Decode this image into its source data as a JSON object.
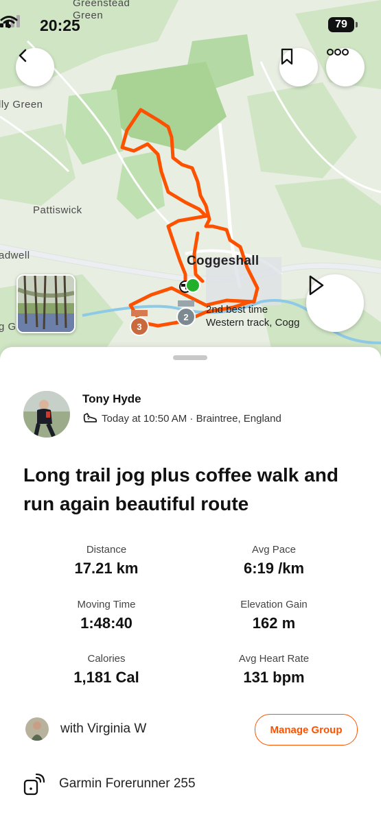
{
  "status_bar": {
    "time": "20:25",
    "battery": "79"
  },
  "map": {
    "places": {
      "greenstead": "Greenstead\nGreen",
      "lly_green": "lly Green",
      "pattiswick": "Pattiswick",
      "adwell": "adwell",
      "coggeshall": "Coggeshall",
      "g_g": "g G"
    },
    "segment_badges": [
      "3",
      "2"
    ],
    "segment_label": {
      "line1": "2nd best time",
      "line2": "Western track, Cogg"
    },
    "route_color": "#fc5200",
    "icons": {
      "back": "chevron-left-icon",
      "bookmark": "bookmark-icon",
      "more": "more-icon",
      "play": "play-icon"
    }
  },
  "activity": {
    "athlete": "Tony Hyde",
    "meta": "Today at 10:50 AM · Braintree, England",
    "title": "Long trail jog  plus coffee walk and run again  beautiful route",
    "stats": [
      {
        "label": "Distance",
        "value": "17.21 km"
      },
      {
        "label": "Avg Pace",
        "value": "6:19 /km"
      },
      {
        "label": "Moving Time",
        "value": "1:48:40"
      },
      {
        "label": "Elevation Gain",
        "value": "162 m"
      },
      {
        "label": "Calories",
        "value": "1,181 Cal"
      },
      {
        "label": "Avg Heart Rate",
        "value": "131 bpm"
      }
    ],
    "with": "with Virginia W",
    "manage_group": "Manage Group",
    "device": "Garmin Forerunner 255",
    "accent": "#fc5200"
  }
}
